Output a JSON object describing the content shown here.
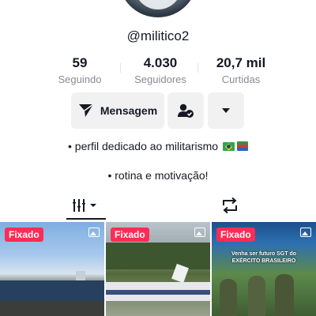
{
  "profile": {
    "username": "@militico2"
  },
  "stats": [
    {
      "value": "59",
      "label": "Seguindo"
    },
    {
      "value": "4.030",
      "label": "Seguidores"
    },
    {
      "value": "20,7 mil",
      "label": "Curtidas"
    }
  ],
  "actions": {
    "message_label": "Mensagem",
    "message_icon": "send-icon",
    "follow_icon": "user-check-icon",
    "more_icon": "chevron-down-icon"
  },
  "bio": {
    "line1": "• perfil dedicado ao militarismo",
    "line1_icons": [
      "brazil-flag-icon",
      "books-icon"
    ],
    "line2": "• rotina e motivação!"
  },
  "tabs": [
    {
      "name": "videos-grid",
      "icon": "grid-bars-icon",
      "active": true
    },
    {
      "name": "reposts",
      "icon": "repost-icon",
      "active": false
    }
  ],
  "videos": [
    {
      "badge": "Fixado",
      "icon": "photo-icon",
      "caption": ""
    },
    {
      "badge": "Fixado",
      "icon": "photo-icon",
      "caption": ""
    },
    {
      "badge": "Fixado",
      "icon": "photo-icon",
      "caption": "Venha ser futuro SGT do EXÉRCITO BRASILEIRO"
    }
  ],
  "colors": {
    "accent": "#fe2c55",
    "text": "#161823",
    "muted": "#8a8b91",
    "button_bg": "#f1f1f2"
  }
}
